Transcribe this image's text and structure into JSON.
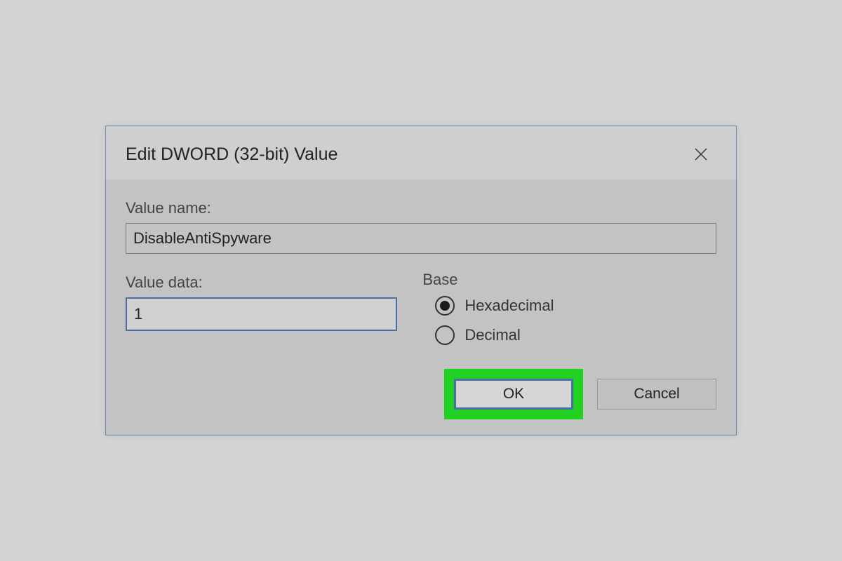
{
  "dialog": {
    "title": "Edit DWORD (32-bit) Value",
    "value_name_label": "Value name:",
    "value_name": "DisableAntiSpyware",
    "value_data_label": "Value data:",
    "value_data": "1",
    "base": {
      "label": "Base",
      "options": {
        "hex": "Hexadecimal",
        "dec": "Decimal"
      },
      "selected": "hex"
    },
    "buttons": {
      "ok": "OK",
      "cancel": "Cancel"
    }
  }
}
